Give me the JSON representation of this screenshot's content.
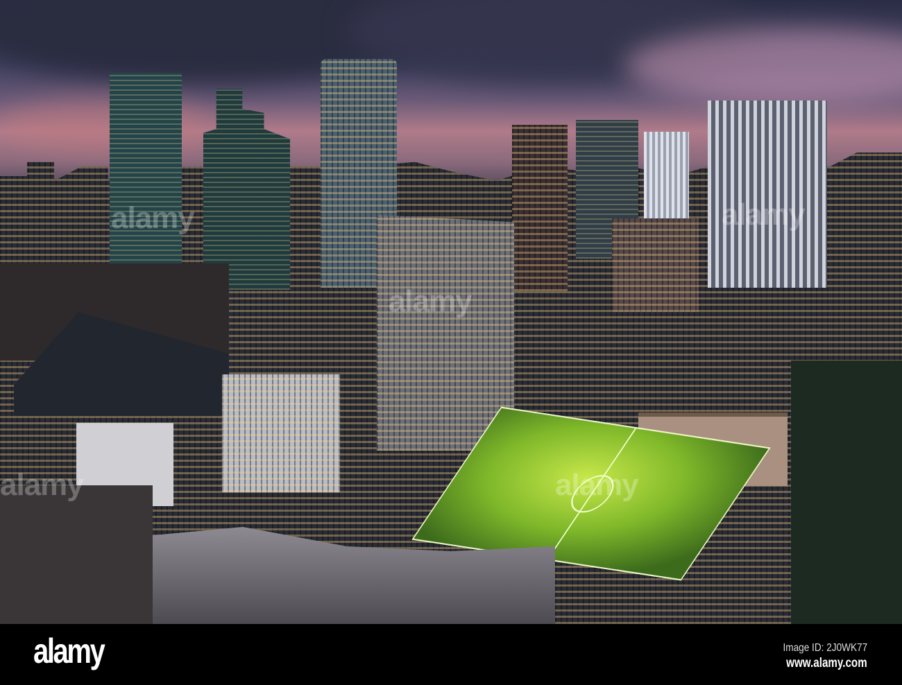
{
  "photo": {
    "subject": "city-skyline-dusk"
  },
  "watermark": {
    "text": "alamy"
  },
  "footer": {
    "logo": "alamy",
    "image_id": "Image ID: 2J0WK77",
    "website": "www.alamy.com"
  }
}
